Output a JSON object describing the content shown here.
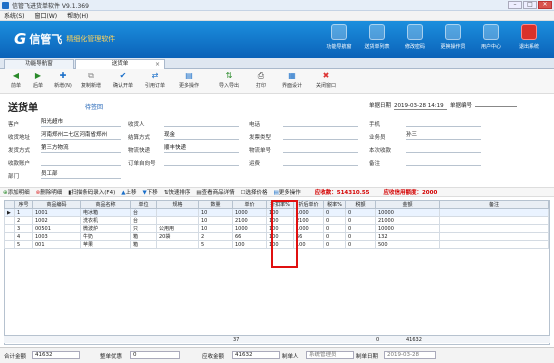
{
  "window": {
    "title": "信管飞进货单软件 V9.1.369",
    "min": "–",
    "max": "□",
    "close": "✕"
  },
  "menu": [
    "系统(S)",
    "窗口(W)",
    "帮助(H)"
  ],
  "brand": {
    "mark": "G",
    "name": "信管飞",
    "slogan": "精细化管理软件"
  },
  "topnav": [
    {
      "label": "功能导航窗",
      "icon": "function-nav-icon"
    },
    {
      "label": "送货单列表",
      "icon": "list-icon"
    },
    {
      "label": "修改密码",
      "icon": "key-icon"
    },
    {
      "label": "更换操作员",
      "icon": "user-switch-icon"
    },
    {
      "label": "用户中心",
      "icon": "globe-icon"
    },
    {
      "label": "退出系统",
      "icon": "power-icon"
    }
  ],
  "tabs": [
    {
      "label": "功能导航窗"
    },
    {
      "label": "送货单",
      "close": "×"
    }
  ],
  "toolbar": [
    {
      "label": "前单",
      "icon": "◀",
      "color": "#2a8a2a"
    },
    {
      "label": "后单",
      "icon": "▶",
      "color": "#2a8a2a"
    },
    {
      "label": "新增(N)",
      "icon": "✚",
      "color": "#1a6fc9"
    },
    {
      "label": "复制新增",
      "icon": "⧉",
      "color": "#888"
    },
    {
      "label": "确认开单",
      "icon": "✔",
      "color": "#1a6fc9"
    },
    {
      "label": "引用订单",
      "icon": "⇄",
      "color": "#1a6fc9"
    },
    {
      "label": "更多操作",
      "icon": "▤",
      "color": "#1a6fc9"
    },
    {
      "label": "导入导出",
      "icon": "⇅",
      "color": "#2a8a2a"
    },
    {
      "label": "打印",
      "icon": "⎙",
      "color": "#444"
    },
    {
      "label": "界面设计",
      "icon": "▦",
      "color": "#1a6fc9"
    },
    {
      "label": "关闭窗口",
      "icon": "✖",
      "color": "#d33"
    }
  ],
  "form": {
    "title": "送货单",
    "status": "待签回",
    "date_label": "单据日期",
    "date": "2019-03-28 14:19",
    "number_label": "单据编号",
    "number": "",
    "fields": [
      {
        "label": "客户",
        "value": "阳光超市"
      },
      {
        "label": "收货地址",
        "value": "河南郑州二七区河南省郑州"
      },
      {
        "label": "发货方式",
        "value": "第三方物流"
      },
      {
        "label": "收款账户",
        "value": ""
      },
      {
        "label": "部门",
        "value": "员工部"
      },
      {
        "label": "收货人",
        "value": ""
      },
      {
        "label": "结算方式",
        "value": "现金"
      },
      {
        "label": "物流快递",
        "value": "顺丰快递"
      },
      {
        "label": "订单自向号",
        "value": ""
      },
      {
        "label": "电话",
        "value": ""
      },
      {
        "label": "发票类型",
        "value": ""
      },
      {
        "label": "物流单号",
        "value": ""
      },
      {
        "label": "运费",
        "value": ""
      },
      {
        "label": "手机",
        "value": ""
      },
      {
        "label": "业务员",
        "value": "孙三"
      },
      {
        "label": "本次收款",
        "value": ""
      },
      {
        "label": "备注",
        "value": ""
      }
    ]
  },
  "gridbar": {
    "add": "添加明细",
    "delete": "删除明细",
    "scan": "扫描条码录入(F4)",
    "up": "上移",
    "down": "下移",
    "quick": "快速排序",
    "inventory": "查看商品详情",
    "price": "选择价格",
    "more": "更多操作",
    "receivable": "应收款：514310.55",
    "credit": "应收信用额度：2000"
  },
  "grid": {
    "headers": [
      "序号",
      "商品编码",
      "商品名称",
      "单位",
      "规格",
      "数量",
      "单价",
      "折扣率%",
      "折后单价",
      "税率%",
      "税额",
      "金额",
      "备注"
    ],
    "rows": [
      [
        "1",
        "1001",
        "电冰箱",
        "台",
        "",
        "10",
        "1000",
        "100",
        "1000",
        "0",
        "0",
        "10000",
        ""
      ],
      [
        "2",
        "1002",
        "洗衣机",
        "台",
        "",
        "10",
        "2100",
        "100",
        "2100",
        "0",
        "0",
        "21000",
        ""
      ],
      [
        "3",
        "00501",
        "微波炉",
        "只",
        "公用用",
        "10",
        "1000",
        "100",
        "1000",
        "0",
        "0",
        "10000",
        ""
      ],
      [
        "4",
        "1003",
        "牛奶",
        "箱",
        "20袋",
        "2",
        "66",
        "100",
        "66",
        "0",
        "0",
        "132",
        ""
      ],
      [
        "5",
        "001",
        "苹果",
        "箱",
        "",
        "5",
        "100",
        "100",
        "100",
        "0",
        "0",
        "500",
        ""
      ]
    ],
    "sum_qty": "37",
    "sum_tax": "0",
    "sum_amount": "41632"
  },
  "bottom": {
    "total_label": "合计金额",
    "total": "41632",
    "discount_label": "整单优惠",
    "discount": "0",
    "receivable_label": "应收金额",
    "receivable": "41632",
    "maker_label": "制单人",
    "maker": "系统管理员",
    "date_label": "制单日期",
    "date": "2019-03-28"
  }
}
